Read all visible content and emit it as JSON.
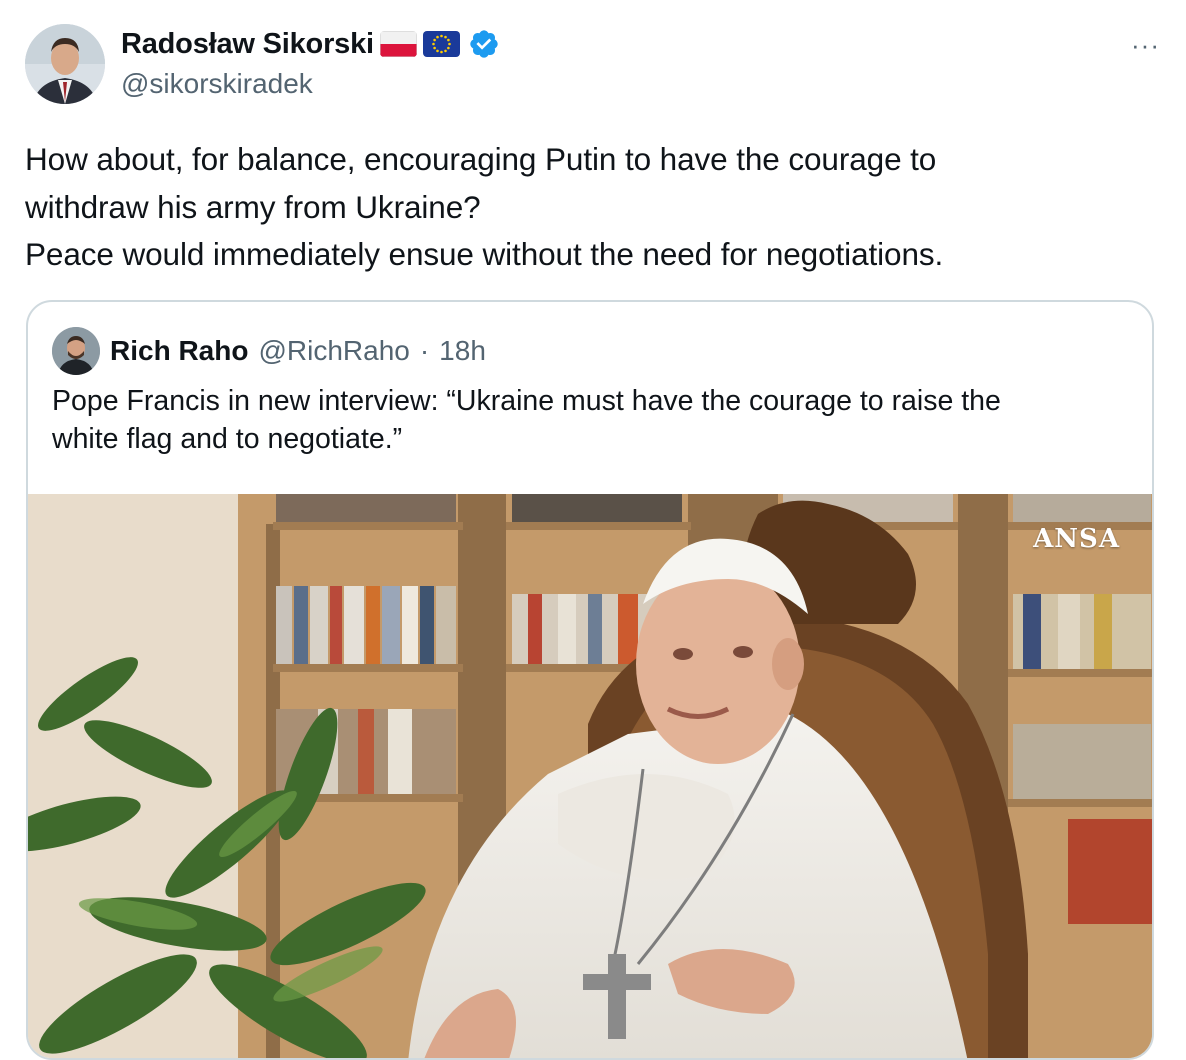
{
  "author": {
    "display_name": "Radosław Sikorski",
    "handle": "@sikorskiradek",
    "flags": [
      "poland-flag",
      "eu-flag"
    ],
    "verified_icon": "verified-badge-icon",
    "avatar_icon": "avatar"
  },
  "more_menu_label": "···",
  "tweet": {
    "text": "How about, for balance, encouraging Putin to have the courage to\nwithdraw his army from Ukraine?\nPeace would immediately ensue without the need for negotiations."
  },
  "quoted": {
    "display_name": "Rich Raho",
    "handle": "@RichRaho",
    "separator": "·",
    "time": "18h",
    "text": "Pope Francis in new interview: “Ukraine must have the courage to raise the\nwhite flag and to negotiate.”",
    "media": {
      "watermark": "ANSA"
    }
  },
  "colors": {
    "text": "#0f1419",
    "secondary": "#536471",
    "border": "#cfd9de",
    "verified": "#1d9bf0"
  }
}
